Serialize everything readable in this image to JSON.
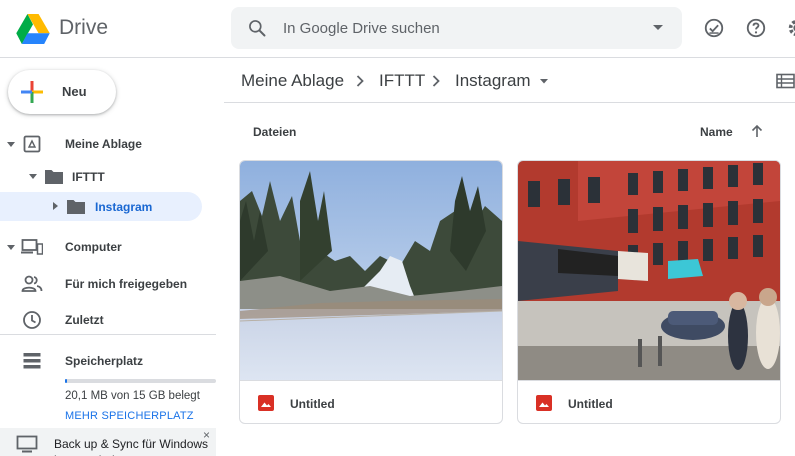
{
  "app": {
    "name": "Drive"
  },
  "search": {
    "placeholder": "In Google Drive suchen"
  },
  "header_icons": [
    "offline-check-icon",
    "help-icon",
    "settings-icon"
  ],
  "new_button": {
    "label": "Neu"
  },
  "sidebar": {
    "my_drive": "Meine Ablage",
    "folder_ifttt": "IFTTT",
    "folder_instagram": "Instagram",
    "computers": "Computer",
    "shared": "Für mich freigegeben",
    "recent": "Zuletzt",
    "storage": "Speicherplatz",
    "storage_used_fraction": 0.0013
  },
  "storage": {
    "usage_text": "20,1 MB von 15 GB belegt",
    "buy_link": "MEHR SPEICHERPLATZ"
  },
  "banner": {
    "text": "Back up & Sync für Windows herunterladen",
    "close": "×"
  },
  "breadcrumb": [
    "Meine Ablage",
    "IFTTT",
    "Instagram"
  ],
  "files": {
    "section_title": "Dateien",
    "sort_label": "Name",
    "items": [
      {
        "name": "Untitled",
        "thumb": "winter-forest-road"
      },
      {
        "name": "Untitled",
        "thumb": "red-brick-street"
      }
    ]
  },
  "colors": {
    "accent": "#1a73e8",
    "selected_bg": "#e8f0fe",
    "image_file_red": "#d93025"
  }
}
